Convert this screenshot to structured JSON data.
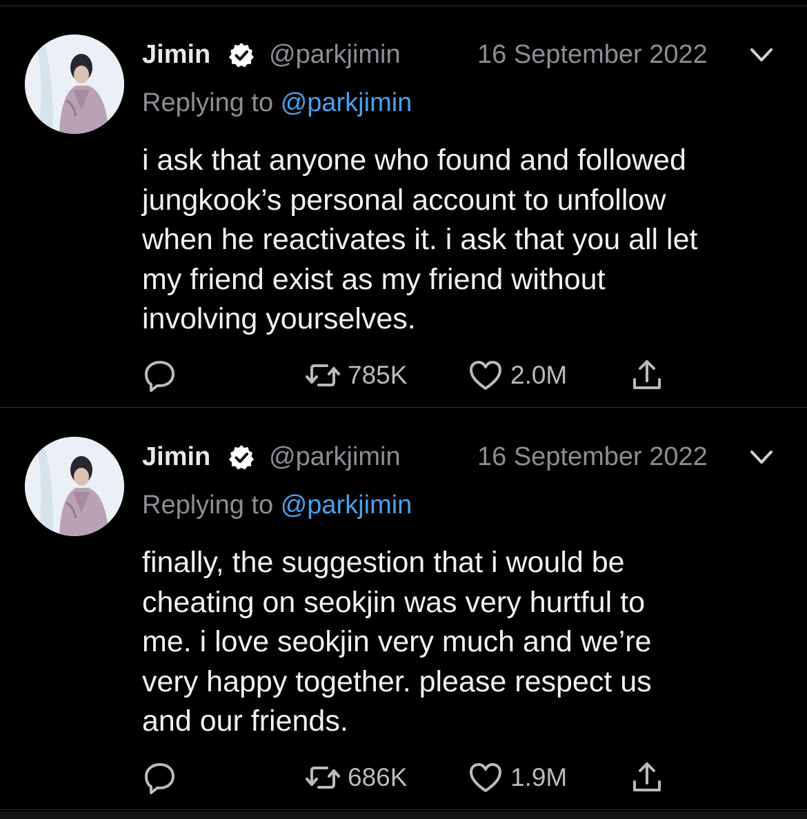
{
  "colors": {
    "background": "#000000",
    "mention": "#4aa1ec",
    "secondary_text": "#8b8f94",
    "divider": "#2f3336"
  },
  "tweets": [
    {
      "author_name": "Jimin",
      "handle": "@parkjimin",
      "date": "16 September 2022",
      "replying_prefix": "Replying to",
      "replying_mention": "@parkjimin",
      "text": "i ask that anyone who found and followed\njungkook’s personal account to unfollow\nwhen he reactivates it. i ask that you all let\nmy friend exist as my friend without\ninvolving yourselves.",
      "retweets": "785K",
      "likes": "2.0M",
      "icons": [
        "verified-badge-icon",
        "chevron-down-icon",
        "reply-icon",
        "retweet-icon",
        "like-icon",
        "share-icon"
      ]
    },
    {
      "author_name": "Jimin",
      "handle": "@parkjimin",
      "date": "16 September 2022",
      "replying_prefix": "Replying to",
      "replying_mention": "@parkjimin",
      "text": "finally, the suggestion that i would be\ncheating on seokjin was very hurtful to\nme. i love seokjin very much and we’re\nvery happy together. please respect us\nand our friends.",
      "retweets": "686K",
      "likes": "1.9M",
      "icons": [
        "verified-badge-icon",
        "chevron-down-icon",
        "reply-icon",
        "retweet-icon",
        "like-icon",
        "share-icon"
      ]
    }
  ]
}
